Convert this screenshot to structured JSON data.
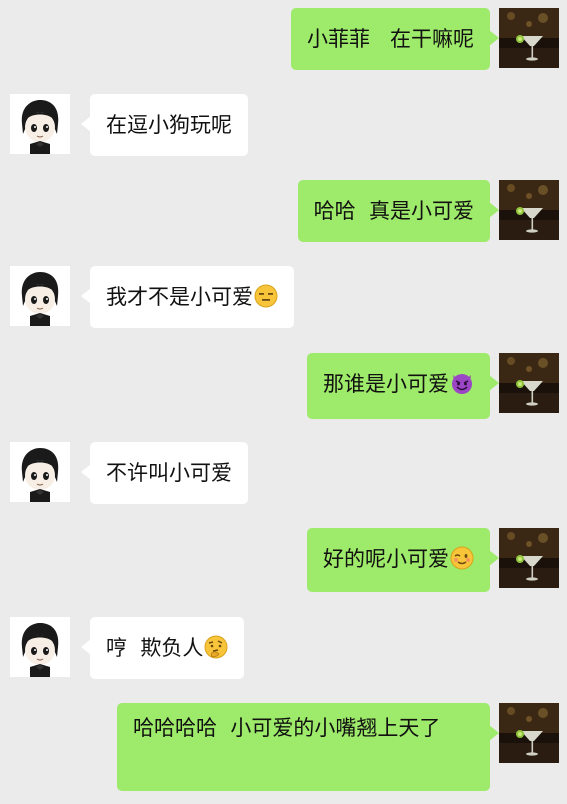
{
  "messages": [
    {
      "side": "right",
      "text": "小菲菲   在干嘛呢",
      "emoji": null
    },
    {
      "side": "left",
      "text": "在逗小狗玩呢",
      "emoji": null
    },
    {
      "side": "right",
      "text": "哈哈  真是小可爱",
      "emoji": null
    },
    {
      "side": "left",
      "text": "我才不是小可爱",
      "emoji": "expressionless-face-icon"
    },
    {
      "side": "right",
      "text": "那谁是小可爱",
      "emoji": "devil-face-icon"
    },
    {
      "side": "left",
      "text": "不许叫小可爱",
      "emoji": null
    },
    {
      "side": "right",
      "text": "好的呢小可爱",
      "emoji": "winking-face-icon"
    },
    {
      "side": "left",
      "text": "哼  欺负人",
      "emoji": "thinking-face-icon"
    },
    {
      "side": "right",
      "text": "哈哈哈哈  小可爱的小嘴翘上天了",
      "emoji": null
    }
  ],
  "colors": {
    "background": "#ebebeb",
    "outgoing_bubble": "#9eea6a",
    "incoming_bubble": "#ffffff"
  }
}
